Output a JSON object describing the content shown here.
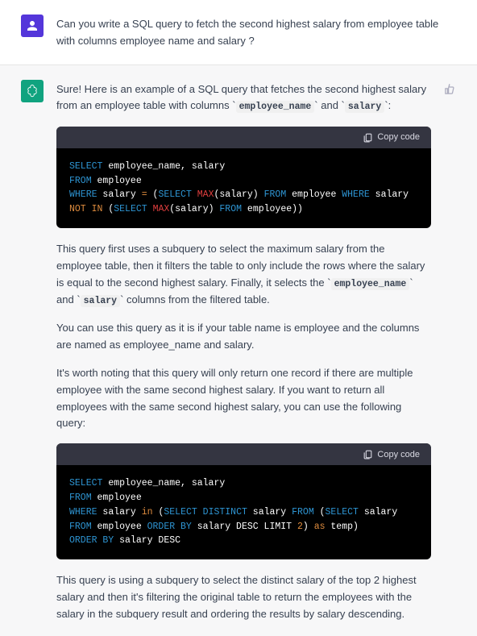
{
  "user_message": {
    "text": "Can you write a SQL query to fetch the second highest salary from employee table with columns employee name and salary ?"
  },
  "assistant_message": {
    "intro_pre": "Sure! Here is an example of a SQL query that fetches the second highest salary from an employee table with columns ",
    "intro_code1": "employee_name",
    "intro_mid": " and ",
    "intro_code2": "salary",
    "intro_post": ":",
    "copy_label": "Copy code",
    "code1_tokens": [
      {
        "t": "SELECT",
        "c": "kw-blue"
      },
      {
        "t": " employee_name, salary\n",
        "c": ""
      },
      {
        "t": "FROM",
        "c": "kw-blue"
      },
      {
        "t": " employee\n",
        "c": ""
      },
      {
        "t": "WHERE",
        "c": "kw-blue"
      },
      {
        "t": " salary ",
        "c": ""
      },
      {
        "t": "=",
        "c": "kw-orange"
      },
      {
        "t": " (",
        "c": ""
      },
      {
        "t": "SELECT",
        "c": "kw-blue"
      },
      {
        "t": " ",
        "c": ""
      },
      {
        "t": "MAX",
        "c": "kw-red"
      },
      {
        "t": "(salary) ",
        "c": ""
      },
      {
        "t": "FROM",
        "c": "kw-blue"
      },
      {
        "t": " employee ",
        "c": ""
      },
      {
        "t": "WHERE",
        "c": "kw-blue"
      },
      {
        "t": " salary ",
        "c": ""
      },
      {
        "t": "NOT IN",
        "c": "kw-orange"
      },
      {
        "t": " (",
        "c": ""
      },
      {
        "t": "SELECT",
        "c": "kw-blue"
      },
      {
        "t": " ",
        "c": ""
      },
      {
        "t": "MAX",
        "c": "kw-red"
      },
      {
        "t": "(salary) ",
        "c": ""
      },
      {
        "t": "FROM",
        "c": "kw-blue"
      },
      {
        "t": " employee))",
        "c": ""
      }
    ],
    "para2_pre": "This query first uses a subquery to select the maximum salary from the employee table, then it filters the table to only include the rows where the salary is equal to the second highest salary. Finally, it selects the ",
    "para2_code1": "employee_name",
    "para2_mid": " and ",
    "para2_code2": "salary",
    "para2_post": " columns from the filtered table.",
    "para3": "You can use this query as it is if your table name is employee and the columns are named as employee_name and salary.",
    "para4": "It's worth noting that this query will only return one record if there are multiple employee with the same second highest salary. If you want to return all employees with the same second highest salary, you can use the following query:",
    "code2_tokens": [
      {
        "t": "SELECT",
        "c": "kw-blue"
      },
      {
        "t": " employee_name, salary\n",
        "c": ""
      },
      {
        "t": "FROM",
        "c": "kw-blue"
      },
      {
        "t": " employee\n",
        "c": ""
      },
      {
        "t": "WHERE",
        "c": "kw-blue"
      },
      {
        "t": " salary ",
        "c": ""
      },
      {
        "t": "in",
        "c": "kw-orange"
      },
      {
        "t": " (",
        "c": ""
      },
      {
        "t": "SELECT DISTINCT",
        "c": "kw-blue"
      },
      {
        "t": " salary ",
        "c": ""
      },
      {
        "t": "FROM",
        "c": "kw-blue"
      },
      {
        "t": " (",
        "c": ""
      },
      {
        "t": "SELECT",
        "c": "kw-blue"
      },
      {
        "t": " salary ",
        "c": ""
      },
      {
        "t": "FROM",
        "c": "kw-blue"
      },
      {
        "t": " employee ",
        "c": ""
      },
      {
        "t": "ORDER BY",
        "c": "kw-blue"
      },
      {
        "t": " salary DESC LIMIT ",
        "c": ""
      },
      {
        "t": "2",
        "c": "kw-orange"
      },
      {
        "t": ") ",
        "c": ""
      },
      {
        "t": "as",
        "c": "kw-orange"
      },
      {
        "t": " temp)\n",
        "c": ""
      },
      {
        "t": "ORDER BY",
        "c": "kw-blue"
      },
      {
        "t": " salary DESC",
        "c": ""
      }
    ],
    "para5": "This query is using a subquery to select the distinct salary of the top 2 highest salary and then it's filtering the original table to return the employees with the salary in the subquery result and ordering the results by salary descending."
  }
}
